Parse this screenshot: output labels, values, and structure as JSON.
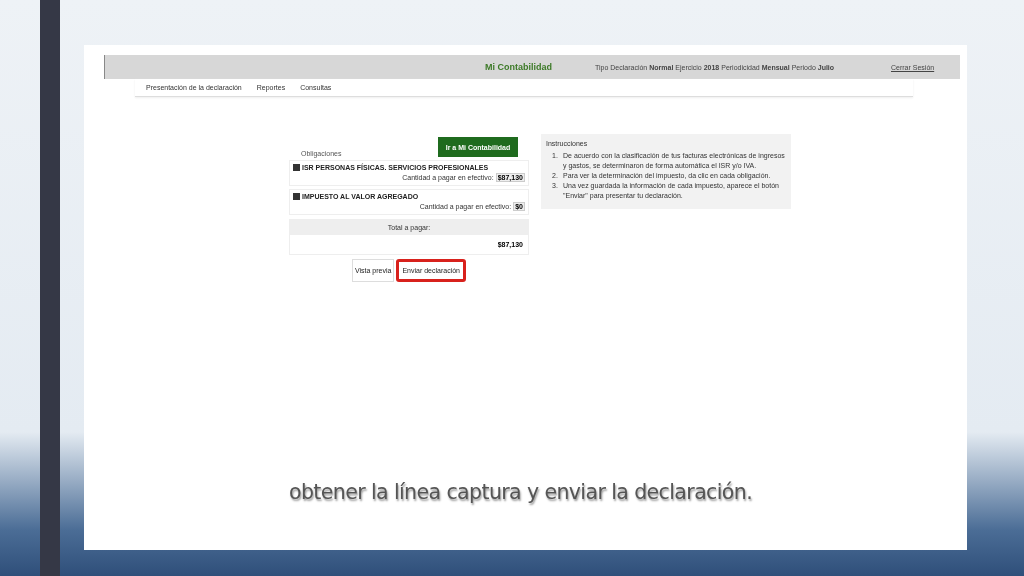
{
  "header": {
    "title": "Mi Contabilidad",
    "info": "Tipo Declaración **Normal** Ejercicio **2018** Periodicidad **Mensual** Periodo **Julio**",
    "logout": "Cerrar Sesión"
  },
  "nav": [
    {
      "label": "Presentación de la declaración"
    },
    {
      "label": "Reportes"
    },
    {
      "label": "Consultas"
    }
  ],
  "obligations": {
    "title": "Obligaciones",
    "button": "Ir a Mi Contabilidad",
    "items": [
      {
        "name": "ISR PERSONAS FÍSICAS. SERVICIOS PROFESIONALES",
        "checked": true,
        "amount_label": "Cantidad a pagar en efectivo:",
        "amount": "$87,130"
      },
      {
        "name": "IMPUESTO AL VALOR AGREGADO",
        "checked": true,
        "amount_label": "Cantidad a pagar en efectivo:",
        "amount": "$0"
      }
    ],
    "total_label": "Total a pagar:",
    "total": "$87,130"
  },
  "instructions": {
    "title": "Instrucciones",
    "steps": [
      {
        "number": "1.",
        "text": "De acuerdo con la clasificación de tus facturas electrónicas de ingresos y gastos, se determinaron de forma automática el ISR y/o IVA."
      },
      {
        "number": "2.",
        "text": "Para ver la determinación del impuesto, da clic en cada obligación."
      },
      {
        "number": "3.",
        "text": "Una vez guardada la información de cada impuesto, aparece el botón \"Enviar\" para presentar tu declaración."
      }
    ]
  },
  "actions": [
    {
      "label": "Vista previa",
      "highlighted": false
    },
    {
      "label": "Enviar declaración",
      "highlighted": true
    }
  ],
  "caption": "obtener la línea captura y enviar la declaración."
}
